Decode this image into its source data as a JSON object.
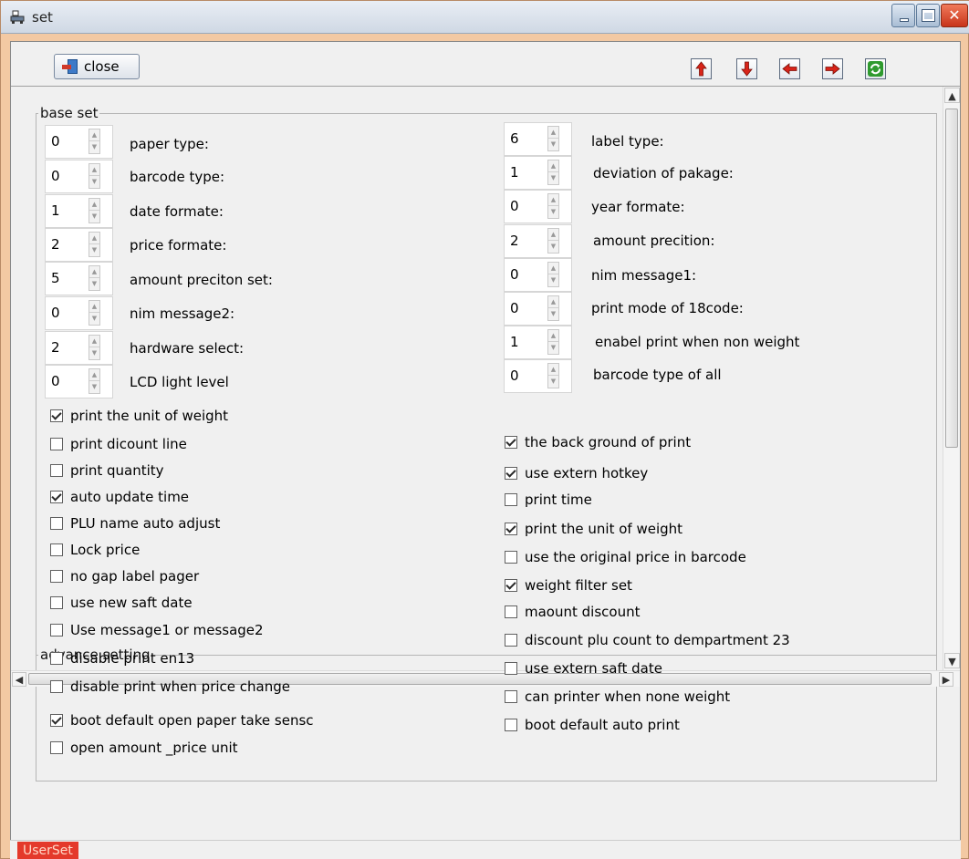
{
  "window": {
    "title": "set"
  },
  "toolbar": {
    "close_label": "close"
  },
  "base_set": {
    "legend": "base set",
    "left_spins": [
      {
        "value": "0",
        "label": "paper type:"
      },
      {
        "value": "0",
        "label": "barcode type:"
      },
      {
        "value": "1",
        "label": "date formate:"
      },
      {
        "value": "2",
        "label": "price formate:"
      },
      {
        "value": "5",
        "label": "amount preciton set:"
      },
      {
        "value": "0",
        "label": "nim message2:"
      },
      {
        "value": "2",
        "label": "hardware select:"
      },
      {
        "value": "0",
        "label": "LCD light level"
      }
    ],
    "right_spins": [
      {
        "value": "6",
        "label": "label type:"
      },
      {
        "value": "1",
        "label": "deviation of pakage:"
      },
      {
        "value": "0",
        "label": "year formate:"
      },
      {
        "value": "2",
        "label": "amount precition:"
      },
      {
        "value": "0",
        "label": "nim message1:"
      },
      {
        "value": "0",
        "label": "print mode of 18code:"
      },
      {
        "value": "1",
        "label": "enabel print when non weight"
      },
      {
        "value": "0",
        "label": "barcode type of all"
      }
    ],
    "left_checks": [
      {
        "label": "print the unit of weight",
        "checked": true
      },
      {
        "label": "print dicount line",
        "checked": false
      },
      {
        "label": "print quantity",
        "checked": false
      },
      {
        "label": "auto update time",
        "checked": true
      },
      {
        "label": "PLU name auto adjust",
        "checked": false
      },
      {
        "label": "Lock price",
        "checked": false
      },
      {
        "label": "no gap label pager",
        "checked": false
      },
      {
        "label": "use new saft date",
        "checked": false
      },
      {
        "label": "Use message1 or message2",
        "checked": false
      },
      {
        "label": "disable print en13",
        "checked": false
      },
      {
        "label": "disable print when price change",
        "checked": false
      },
      {
        "label": "boot default open paper take sensc",
        "checked": true
      },
      {
        "label": "open amount _price unit",
        "checked": false
      }
    ],
    "right_checks": [
      {
        "label": "the back ground of print",
        "checked": true
      },
      {
        "label": "use extern hotkey",
        "checked": true
      },
      {
        "label": "print time",
        "checked": false
      },
      {
        "label": "print the unit of weight",
        "checked": true
      },
      {
        "label": "use the original price in barcode",
        "checked": false
      },
      {
        "label": "weight filter set",
        "checked": true
      },
      {
        "label": "maount discount",
        "checked": false
      },
      {
        "label": "discount plu count to dempartment 23",
        "checked": false
      },
      {
        "label": "use extern saft date",
        "checked": false
      },
      {
        "label": "can printer when none weight",
        "checked": false
      },
      {
        "label": "boot default auto print",
        "checked": false
      }
    ]
  },
  "advance": {
    "legend": "advance setting"
  },
  "status": {
    "badge": "UserSet"
  }
}
